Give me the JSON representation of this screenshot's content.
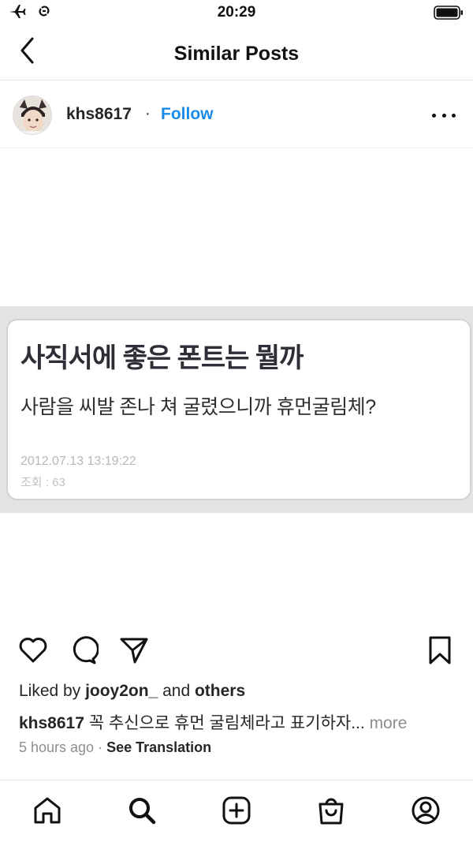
{
  "status_bar": {
    "time": "20:29",
    "icons": [
      "airplane-icon",
      "link-icon",
      "battery-icon"
    ]
  },
  "nav": {
    "title": "Similar Posts",
    "back_icon": "chevron-left-icon"
  },
  "post": {
    "username": "khs8617",
    "separator": "·",
    "follow_label": "Follow",
    "more_icon": "more-horizontal-icon",
    "image": {
      "title": "사직서에 좋은 폰트는 뭘까",
      "body": "사람을 씨발 존나 쳐 굴렸으니까 휴먼굴림체?",
      "date": "2012.07.13 13:19:22",
      "views": "조회 : 63"
    },
    "actions": [
      "heart-icon",
      "comment-icon",
      "share-icon",
      "bookmark-icon"
    ],
    "likes": {
      "prefix": "Liked by",
      "user": "jooy2on_",
      "and": "and",
      "others": "others"
    },
    "caption": {
      "user": "khs8617",
      "text": "꼭 추신으로 휴먼 굴림체라고 표기하자...",
      "more": "more"
    },
    "time_ago": "5 hours ago",
    "meta_separator": "·",
    "see_translation": "See Translation"
  },
  "tab_bar": {
    "tabs": [
      "home-icon",
      "search-icon",
      "new-post-icon",
      "shop-icon",
      "profile-icon"
    ]
  },
  "colors": {
    "accent": "#1a8ae8",
    "text": "#262626",
    "muted": "#8e8e8e"
  }
}
